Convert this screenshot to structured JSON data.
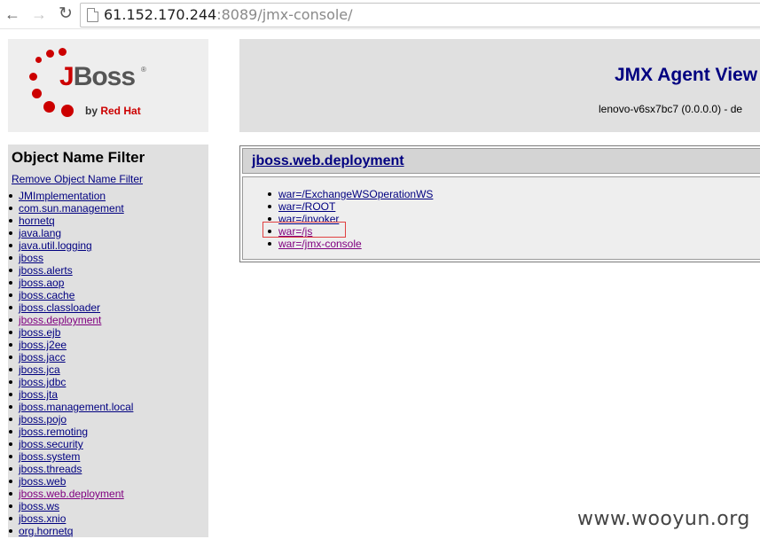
{
  "browser": {
    "url_host": "61.152.170.244",
    "url_rest": ":8089/jmx-console/",
    "back_icon": "←",
    "forward_icon": "→",
    "reload_icon": "↻"
  },
  "logo": {
    "wordmark_j": "J",
    "wordmark_rest": "Boss",
    "registered": "®",
    "by": "by ",
    "redhat": "Red Hat",
    "brand_color": "#cc0000"
  },
  "filter": {
    "title": "Object Name Filter",
    "remove_label": "Remove Object Name Filter",
    "domains": [
      {
        "label": "JMImplementation",
        "visited": false
      },
      {
        "label": "com.sun.management",
        "visited": false
      },
      {
        "label": "hornetq",
        "visited": false
      },
      {
        "label": "java.lang",
        "visited": false
      },
      {
        "label": "java.util.logging",
        "visited": false
      },
      {
        "label": "jboss",
        "visited": false
      },
      {
        "label": "jboss.alerts",
        "visited": false
      },
      {
        "label": "jboss.aop",
        "visited": false
      },
      {
        "label": "jboss.cache",
        "visited": false
      },
      {
        "label": "jboss.classloader",
        "visited": false
      },
      {
        "label": "jboss.deployment",
        "visited": true
      },
      {
        "label": "jboss.ejb",
        "visited": false
      },
      {
        "label": "jboss.j2ee",
        "visited": false
      },
      {
        "label": "jboss.jacc",
        "visited": false
      },
      {
        "label": "jboss.jca",
        "visited": false
      },
      {
        "label": "jboss.jdbc",
        "visited": false
      },
      {
        "label": "jboss.jta",
        "visited": false
      },
      {
        "label": "jboss.management.local",
        "visited": false
      },
      {
        "label": "jboss.pojo",
        "visited": false
      },
      {
        "label": "jboss.remoting",
        "visited": false
      },
      {
        "label": "jboss.security",
        "visited": false
      },
      {
        "label": "jboss.system",
        "visited": false
      },
      {
        "label": "jboss.threads",
        "visited": false
      },
      {
        "label": "jboss.web",
        "visited": false
      },
      {
        "label": "jboss.web.deployment",
        "visited": true
      },
      {
        "label": "jboss.ws",
        "visited": false
      },
      {
        "label": "jboss.xnio",
        "visited": false
      },
      {
        "label": "org.hornetq",
        "visited": false
      }
    ]
  },
  "header": {
    "title": "JMX Agent View",
    "subtitle": "lenovo-v6sx7bc7 (0.0.0.0) - de"
  },
  "domain_section": {
    "title": "jboss.web.deployment",
    "mbeans": [
      {
        "label": "war=/ExchangeWSOperationWS",
        "visited": false
      },
      {
        "label": "war=/ROOT",
        "visited": false
      },
      {
        "label": "war=/invoker",
        "visited": false
      },
      {
        "label": "war=/js",
        "visited": true
      },
      {
        "label": "war=/jmx-console",
        "visited": true
      }
    ],
    "highlight_color": "#e04040"
  },
  "watermark": "www.wooyun.org"
}
